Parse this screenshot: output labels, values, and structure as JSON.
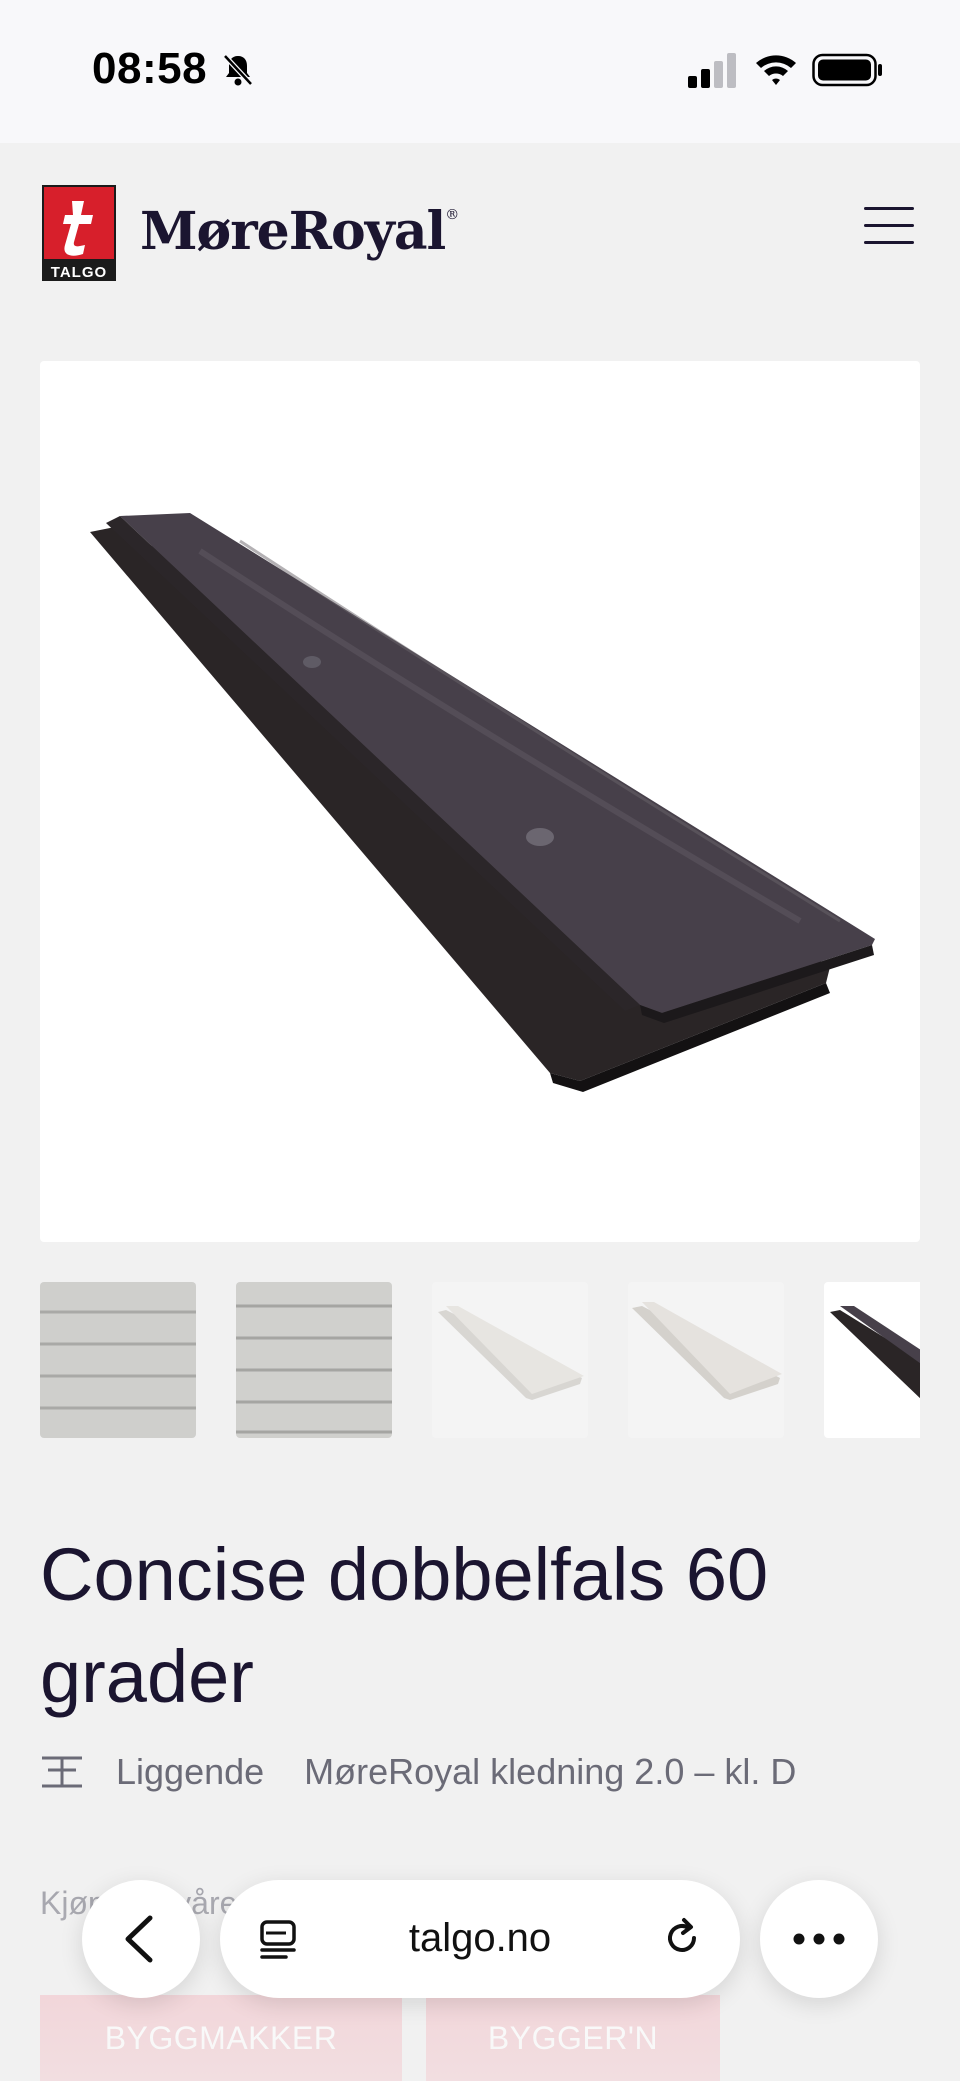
{
  "status_bar": {
    "time": "08:58",
    "icons": [
      "bell-slash-icon",
      "cellular-signal-icon",
      "wifi-icon",
      "battery-icon"
    ]
  },
  "header": {
    "logo_letter": "t",
    "logo_caption": "TALGO",
    "brand_name": "MøreRoyal",
    "brand_mark": "®",
    "menu_icon": "hamburger-menu-icon"
  },
  "product": {
    "title": "Concise dobbelfals 60 grader",
    "orientation": "Liggende",
    "series": "MøreRoyal kledning 2.0 – kl. D",
    "orientation_icon": "horizontal-panel-icon"
  },
  "gallery": {
    "thumbnails": [
      "grey-panel-wall",
      "grey-panel-wall-alt",
      "white-board-pair",
      "white-board-pair-alt",
      "dark-board-pair"
    ]
  },
  "purchase": {
    "label": "Kjøp hos våre forhandlere",
    "retailers": [
      "BYGGMAKKER",
      "BYGGER'N"
    ]
  },
  "browser": {
    "url": "talgo.no",
    "icons": [
      "back-chevron-icon",
      "tabs-icon",
      "reload-icon",
      "more-dots-icon"
    ]
  },
  "colors": {
    "brand_red": "#d71f2b",
    "text_dark": "#1b1530",
    "retailer_pink": "#f3c7cd",
    "page_bg": "#f1f1f1"
  }
}
